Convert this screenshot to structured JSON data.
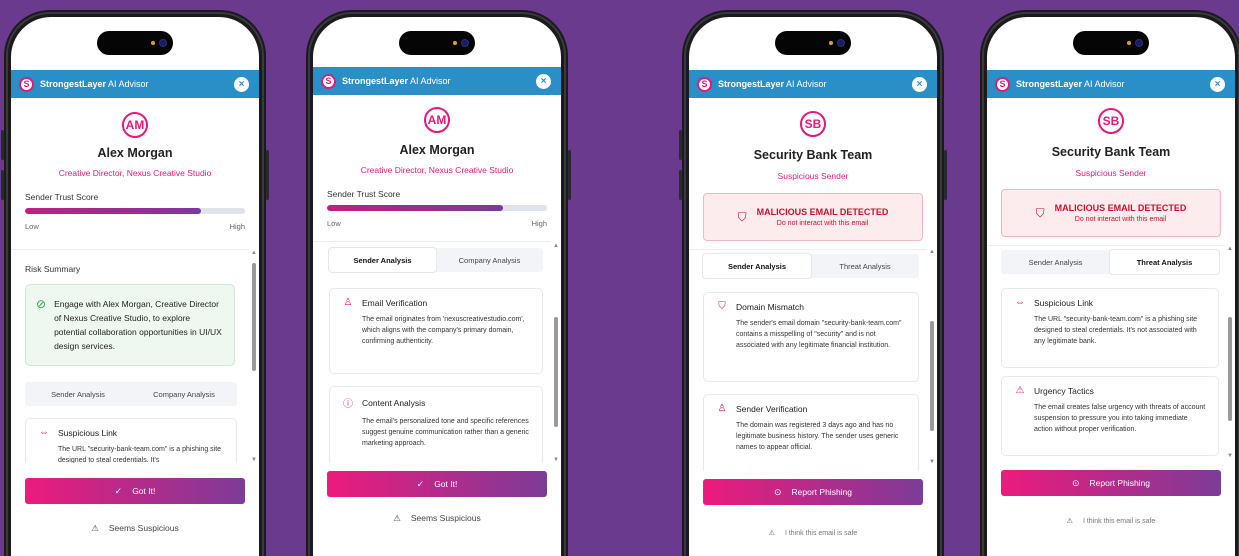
{
  "header": {
    "brand_bold": "StrongestLayer",
    "brand_rest": " AI Advisor",
    "logo_letter": "S",
    "close": "×"
  },
  "phones": [
    {
      "avatar": "AM",
      "name": "Alex Morgan",
      "subtitle": "Creative Director, Nexus Creative Studio",
      "trust": {
        "label": "Sender Trust Score",
        "low": "Low",
        "high": "High",
        "value": 0.8
      },
      "risk_title": "Risk Summary",
      "risk_text": "Engage with Alex Morgan, Creative Director of Nexus Creative Studio, to explore potential collaboration opportunities in UI/UX design services.",
      "tabs": [
        "Sender Analysis",
        "Company Analysis"
      ],
      "card": {
        "title": "Suspicious Link",
        "body": "The URL \"security-bank-team.com\" is a phishing site designed to steal credentials. It's"
      },
      "cta": "Got It!",
      "secondary": "Seems Suspicious"
    },
    {
      "avatar": "AM",
      "name": "Alex Morgan",
      "subtitle": "Creative Director, Nexus Creative Studio",
      "trust": {
        "label": "Sender Trust Score",
        "low": "Low",
        "high": "High",
        "value": 0.8
      },
      "tabs": [
        "Sender Analysis",
        "Company Analysis"
      ],
      "cards": [
        {
          "title": "Email Verification",
          "body": "The email originates from 'nexuscreativestudio.com', which aligns with the company's primary domain, confirming authenticity."
        },
        {
          "title": "Content Analysis",
          "body": "The email's personalized tone and specific references suggest genuine communication rather than a generic marketing approach."
        }
      ],
      "cta": "Got It!",
      "secondary": "Seems Suspicious"
    },
    {
      "avatar": "SB",
      "name": "Security Bank Team",
      "subtitle": "Suspicious Sender",
      "alert": {
        "title": "MALICIOUS EMAIL DETECTED",
        "sub": "Do not interact with this email"
      },
      "tabs": [
        "Sender Analysis",
        "Threat Analysis"
      ],
      "cards": [
        {
          "title": "Domain Mismatch",
          "body": "The sender's email domain \"security-bank-team.com\" contains a misspelling of \"security\" and is not associated with any legitimate financial institution."
        },
        {
          "title": "Sender Verification",
          "body": "The domain was registered 3 days ago and has no legitimate business history. The sender uses generic names to appear official."
        }
      ],
      "cta": "Report Phishing",
      "secondary": "I think this email is safe"
    },
    {
      "avatar": "SB",
      "name": "Security Bank Team",
      "subtitle": "Suspicious Sender",
      "alert": {
        "title": "MALICIOUS EMAIL DETECTED",
        "sub": "Do not interact with this email"
      },
      "tabs": [
        "Sender Analysis",
        "Threat Analysis"
      ],
      "cards": [
        {
          "title": "Suspicious Link",
          "body": "The URL \"security-bank-team.com\" is a phishing site designed to steal credentials. It's not associated with any legitimate bank."
        },
        {
          "title": "Urgency Tactics",
          "body": "The email creates false urgency with threats of account suspension to pressure you into taking immediate action without proper verification."
        }
      ],
      "cta": "Report Phishing",
      "secondary": "I think this email is safe"
    }
  ],
  "colors": {
    "background": "#6a3a8e",
    "header": "#2a8ec7",
    "accent": "#e3197a",
    "alert": "#c8102e",
    "success": "#2ea44f"
  },
  "icons": {
    "check": "check-circle-icon",
    "warning": "warning-triangle-icon",
    "shield": "shield-icon",
    "user": "user-icon",
    "info": "info-icon",
    "link": "link-icon",
    "alert": "alert-square-icon",
    "report": "report-circle-icon"
  }
}
